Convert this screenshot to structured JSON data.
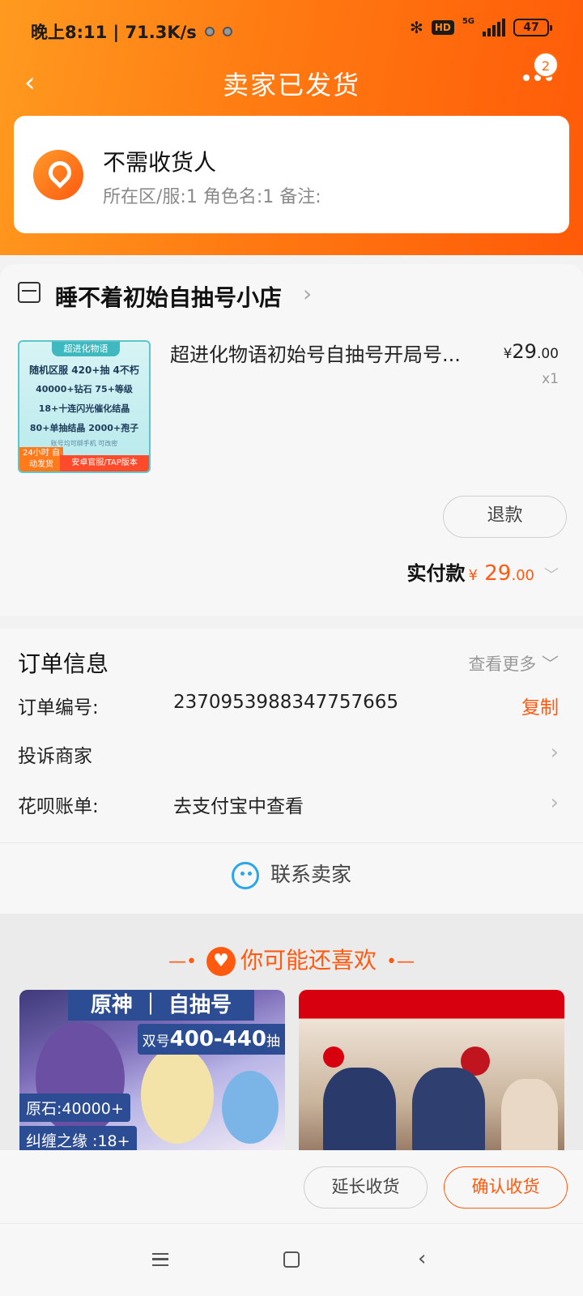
{
  "status_bar": {
    "time_speed": "晚上8:11 | 71.3K/s",
    "network": "5G",
    "hd": "HD",
    "battery": "47"
  },
  "nav": {
    "title": "卖家已发货",
    "badge_count": "2"
  },
  "address": {
    "title": "不需收货人",
    "detail": "所在区/服:1 角色名:1 备注:"
  },
  "shop": {
    "name": "睡不着初始自抽号小店"
  },
  "item": {
    "title": "超进化物语初始号自抽号开局号...",
    "price_currency": "¥",
    "price_int": "29",
    "price_dec": ".00",
    "quantity": "x1",
    "thumbnail": {
      "head": "超进化物语",
      "line1": "随机区服 420+抽 4不朽",
      "line2": "40000+钻石 75+等级",
      "line3": "18+十连闪光催化结晶",
      "line4": "80+单抽结晶 2000+孢子",
      "line5": "账号均可绑手机 可改密",
      "foot_left": "24小时 自动发货",
      "foot_right": "安卓官服/TAP版本"
    }
  },
  "refund_label": "退款",
  "paid": {
    "label": "实付款",
    "currency": "¥",
    "amount_int": "29",
    "amount_dec": ".00"
  },
  "order_info": {
    "title": "订单信息",
    "more": "查看更多",
    "order_no_label": "订单编号:",
    "order_no_value": "2370953988347757665",
    "copy_label": "复制",
    "complain_label": "投诉商家",
    "huabei_label": "花呗账单:",
    "huabei_value": "去支付宝中查看",
    "contact_label": "联系卖家"
  },
  "recommend": {
    "title": "你可能还喜欢",
    "card1": {
      "head_left": "原神",
      "head_right": "自抽号",
      "tag1_prefix": "双号",
      "tag1_value": "400-440",
      "tag1_suffix": "抽",
      "tag2": "原石:40000+",
      "tag3": "纠缠之缘 :18+"
    }
  },
  "bottom_actions": {
    "extend_label": "延长收货",
    "confirm_label": "确认收货"
  },
  "colors": {
    "accent": "#ff5a10",
    "header_gradient_start": "#ff9a1f",
    "header_gradient_end": "#ff5a08"
  }
}
